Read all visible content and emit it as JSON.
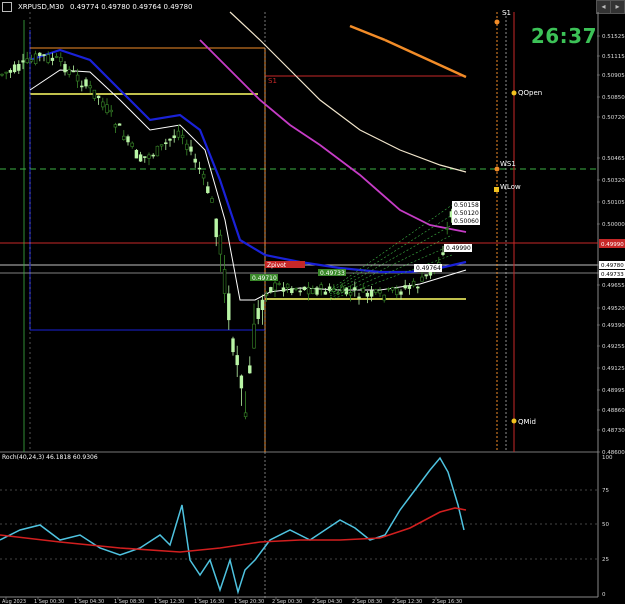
{
  "window": {
    "symbol": "XRPUSD,M30",
    "ohlc": "0.49774 0.49780 0.49764 0.49780",
    "countdown": "26:37"
  },
  "price_axis": {
    "labels": [
      "0.51525",
      "0.51115",
      "0.50905",
      "0.50850",
      "0.50720",
      "0.50465",
      "0.50320",
      "0.50105",
      "0.50000",
      "0.49780",
      "0.49733",
      "0.49655",
      "0.49520",
      "0.49390",
      "0.49255",
      "0.49125",
      "0.48995",
      "0.48860",
      "0.48730",
      "0.48600"
    ],
    "highlight_red": "0.49990",
    "highlight_white": [
      "0.49780",
      "0.49733"
    ]
  },
  "level_labels": {
    "qopen": "QOpen",
    "ws1": "WS1",
    "wlow": "WLow",
    "qmid": "QMid",
    "s1": "S1",
    "top_left": "S1"
  },
  "chart_tags": {
    "t1": "0.50158",
    "t2": "0.50120",
    "t3": "0.50060",
    "t4": "0.49990",
    "t5": "0.49764",
    "t6": "0.49733",
    "t7": "Zpivot",
    "t8": "0.49710"
  },
  "indicator": {
    "label": "Roch(40,24,3) 46.1818 60.9306",
    "levels": [
      "100",
      "75",
      "50",
      "25",
      "0"
    ]
  },
  "time_axis": {
    "labels": [
      "Aug 2023",
      "1 Sep 00:30",
      "1 Sep 04:30",
      "1 Sep 08:30",
      "1 Sep 12:30",
      "1 Sep 16:30",
      "1 Sep 20:30",
      "2 Sep 00:30",
      "2 Sep 04:30",
      "2 Sep 08:30",
      "2 Sep 12:30",
      "2 Sep 16:30"
    ]
  },
  "colors": {
    "bg": "#000000",
    "bull_candle": "#b9f5a6",
    "bear_candle": "#3a8a2a",
    "ma_blue": "#1a22d8",
    "ma_magenta": "#c63cc6",
    "ma_cream": "#f2e6cc",
    "ma_white": "#ffffff",
    "orange": "#f28c28",
    "yellow": "#ffff66",
    "green_dash": "#3cb043",
    "red": "#c62828",
    "osc_cyan": "#4fc3e0",
    "osc_red": "#d21f1f",
    "clock": "#3cc257"
  }
}
